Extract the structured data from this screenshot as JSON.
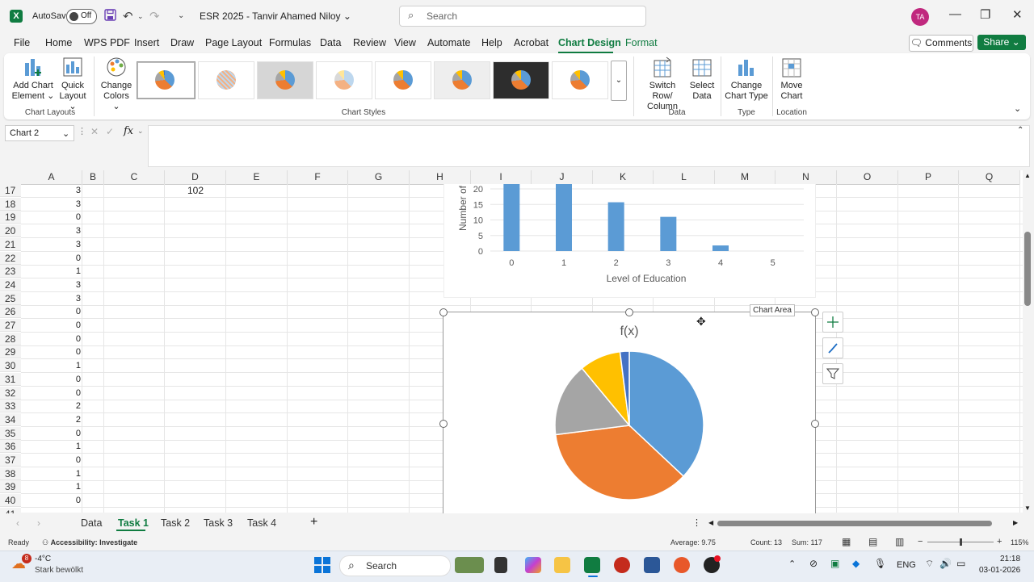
{
  "titlebar": {
    "autosave_label": "AutoSave",
    "autosave_state": "Off",
    "doc_title": "ESR 2025 - Tanvir Ahamed Niloy",
    "search_placeholder": "Search",
    "avatar_initials": "TA"
  },
  "menu": {
    "items": [
      "File",
      "Home",
      "WPS PDF",
      "Insert",
      "Draw",
      "Page Layout",
      "Formulas",
      "Data",
      "Review",
      "View",
      "Automate",
      "Help",
      "Acrobat",
      "Chart Design",
      "Format"
    ],
    "active": "Chart Design",
    "comments": "Comments",
    "share": "Share"
  },
  "ribbon": {
    "add_chart_element": [
      "Add Chart",
      "Element"
    ],
    "quick_layout": [
      "Quick",
      "Layout"
    ],
    "change_colors": [
      "Change",
      "Colors"
    ],
    "group_chart_layouts": "Chart Layouts",
    "group_chart_styles": "Chart Styles",
    "switch_row_col": [
      "Switch Row/",
      "Column"
    ],
    "select_data": [
      "Select",
      "Data"
    ],
    "group_data": "Data",
    "change_chart_type": [
      "Change",
      "Chart Type"
    ],
    "group_type": "Type",
    "move_chart": [
      "Move",
      "Chart"
    ],
    "group_location": "Location",
    "accent": "#107c41"
  },
  "formula_bar": {
    "name_box": "Chart 2",
    "fx": "fx",
    "content": ""
  },
  "columns": [
    "A",
    "B",
    "C",
    "D",
    "E",
    "F",
    "G",
    "H",
    "I",
    "J",
    "K",
    "L",
    "M",
    "N",
    "O",
    "P",
    "Q"
  ],
  "rows": [
    {
      "n": "17",
      "a": "3"
    },
    {
      "n": "18",
      "a": "3"
    },
    {
      "n": "19",
      "a": "0"
    },
    {
      "n": "20",
      "a": "3"
    },
    {
      "n": "21",
      "a": "3"
    },
    {
      "n": "22",
      "a": "0"
    },
    {
      "n": "23",
      "a": "1"
    },
    {
      "n": "24",
      "a": "3"
    },
    {
      "n": "25",
      "a": "3"
    },
    {
      "n": "26",
      "a": "0"
    },
    {
      "n": "27",
      "a": "0"
    },
    {
      "n": "28",
      "a": "0"
    },
    {
      "n": "29",
      "a": "0"
    },
    {
      "n": "30",
      "a": "1"
    },
    {
      "n": "31",
      "a": "0"
    },
    {
      "n": "32",
      "a": "0"
    },
    {
      "n": "33",
      "a": "2"
    },
    {
      "n": "34",
      "a": "2"
    },
    {
      "n": "35",
      "a": "0"
    },
    {
      "n": "36",
      "a": "1"
    },
    {
      "n": "37",
      "a": "0"
    },
    {
      "n": "38",
      "a": "1"
    },
    {
      "n": "39",
      "a": "1"
    },
    {
      "n": "40",
      "a": "0"
    },
    {
      "n": "41",
      "a": ""
    }
  ],
  "cell_d17": "102",
  "chart_data": [
    {
      "type": "bar",
      "xlabel": "Level of Education",
      "ylabel": "Number of",
      "categories": [
        "0",
        "1",
        "2",
        "3",
        "4",
        "5"
      ],
      "values": [
        24,
        24,
        15.7,
        11,
        1.8,
        0
      ],
      "ylim": [
        0,
        20
      ],
      "yticks": [
        "0",
        "5",
        "10",
        "15",
        "20"
      ],
      "color": "#5b9bd5"
    },
    {
      "type": "pie",
      "title": "f(x)",
      "values": [
        37,
        36,
        16,
        9,
        2
      ],
      "colors": [
        "#5b9bd5",
        "#ed7d31",
        "#a5a5a5",
        "#ffc000",
        "#4472c4"
      ]
    }
  ],
  "chart_area_tooltip": "Chart Area",
  "sheets": [
    "Data",
    "Task 1",
    "Task 2",
    "Task 3",
    "Task 4"
  ],
  "active_sheet": "Task 1",
  "status": {
    "ready": "Ready",
    "accessibility": "Accessibility: Investigate",
    "average": "Average: 9.75",
    "count": "Count: 13",
    "sum": "Sum: 117",
    "zoom": "115%"
  },
  "taskbar": {
    "weather_temp": "-4°C",
    "weather_desc": "Stark bewölkt",
    "weather_badge": "8",
    "search": "Search",
    "lang": "ENG",
    "time": "21:18",
    "date": "03-01-2026"
  }
}
